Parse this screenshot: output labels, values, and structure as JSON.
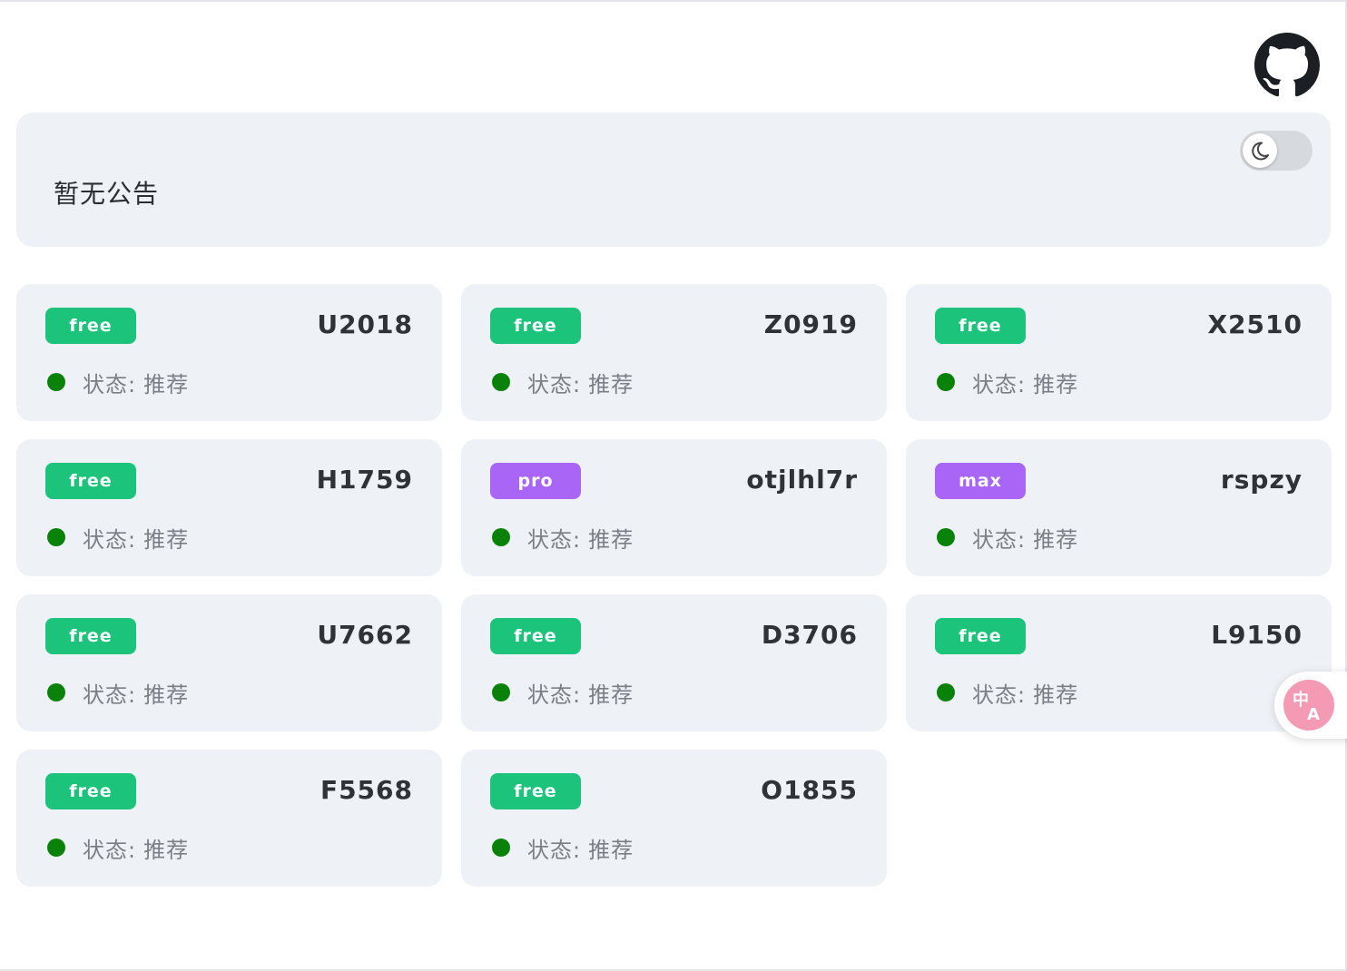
{
  "header": {
    "github_icon": "github-icon"
  },
  "notice": {
    "text": "暂无公告",
    "theme_toggle_icon": "moon-icon"
  },
  "status": {
    "label": "状态:",
    "dot_color": "#0a820a"
  },
  "colors": {
    "free": "#1cc47b",
    "pro": "#a966f6",
    "max": "#a966f6",
    "card_background": "#eef2f6"
  },
  "cards": [
    {
      "tier": "free",
      "code": "U2018",
      "status_value": "推荐"
    },
    {
      "tier": "free",
      "code": "Z0919",
      "status_value": "推荐"
    },
    {
      "tier": "free",
      "code": "X2510",
      "status_value": "推荐"
    },
    {
      "tier": "free",
      "code": "H1759",
      "status_value": "推荐"
    },
    {
      "tier": "pro",
      "code": "otjlhl7r",
      "status_value": "推荐"
    },
    {
      "tier": "max",
      "code": "rspzy",
      "status_value": "推荐"
    },
    {
      "tier": "free",
      "code": "U7662",
      "status_value": "推荐"
    },
    {
      "tier": "free",
      "code": "D3706",
      "status_value": "推荐"
    },
    {
      "tier": "free",
      "code": "L9150",
      "status_value": "推荐"
    },
    {
      "tier": "free",
      "code": "F5568",
      "status_value": "推荐"
    },
    {
      "tier": "free",
      "code": "O1855",
      "status_value": "推荐"
    }
  ],
  "translate_widget": {
    "icon": "translate-icon"
  }
}
